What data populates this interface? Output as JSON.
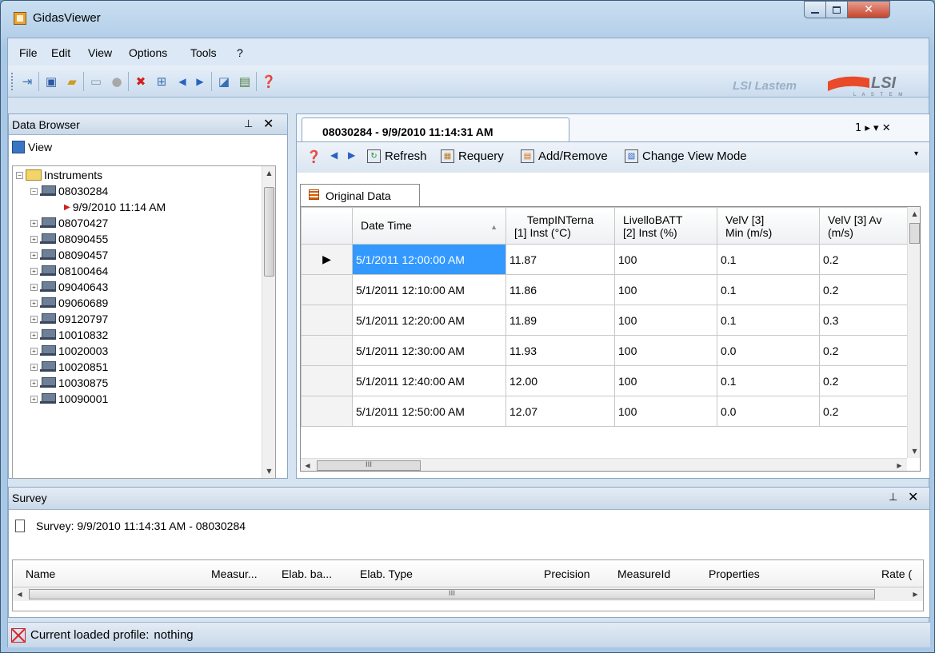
{
  "window": {
    "title": "GidasViewer"
  },
  "menu": [
    "File",
    "Edit",
    "View",
    "Options",
    "Tools",
    "?"
  ],
  "toolbar": {
    "icons": [
      "exit-icon",
      "save-icon",
      "open-folder-icon",
      "connect-icon",
      "disconnect-icon",
      "delete-icon",
      "grid-icon",
      "previous-icon",
      "next-icon",
      "chart-icon",
      "report-icon",
      "help-icon"
    ],
    "brand": "LSI Lastem",
    "logo": "LSI"
  },
  "data_browser": {
    "title": "Data Browser",
    "view_label": "View",
    "tree": {
      "root": "Instruments",
      "expanded": {
        "label": "08030284",
        "child": "9/9/2010 11:14 AM"
      },
      "items": [
        "08070427",
        "08090455",
        "08090457",
        "08100464",
        "09040643",
        "09060689",
        "09120797",
        "10010832",
        "10020003",
        "10020851",
        "10030875",
        "10090001"
      ]
    }
  },
  "document": {
    "tab_title": "08030284 - 9/9/2010 11:14:31 AM",
    "tab_controls": "1 ▸ ▾ ✕",
    "toolstrip": {
      "refresh": "Refresh",
      "requery": "Requery",
      "add_remove": "Add/Remove",
      "change_view_mode": "Change View Mode"
    },
    "sub_tab": "Original Data",
    "grid": {
      "columns": [
        {
          "line1": "Date Time",
          "line2": ""
        },
        {
          "line1": "TempINTerna",
          "line2": "[1] Inst (°C)"
        },
        {
          "line1": "LivelloBATT",
          "line2": "[2] Inst (%)"
        },
        {
          "line1": "VelV [3]",
          "line2": "Min (m/s)"
        },
        {
          "line1": "VelV [3] Av",
          "line2": "(m/s)"
        }
      ],
      "rows": [
        [
          "5/1/2011 12:00:00 AM",
          "11.87",
          "100",
          "0.1",
          "0.2"
        ],
        [
          "5/1/2011 12:10:00 AM",
          "11.86",
          "100",
          "0.1",
          "0.2"
        ],
        [
          "5/1/2011 12:20:00 AM",
          "11.89",
          "100",
          "0.1",
          "0.3"
        ],
        [
          "5/1/2011 12:30:00 AM",
          "11.93",
          "100",
          "0.0",
          "0.2"
        ],
        [
          "5/1/2011 12:40:00 AM",
          "12.00",
          "100",
          "0.1",
          "0.2"
        ],
        [
          "5/1/2011 12:50:00 AM",
          "12.07",
          "100",
          "0.0",
          "0.2"
        ]
      ],
      "hscroll_grip": "III"
    }
  },
  "survey": {
    "title": "Survey",
    "caption": "Survey: 9/9/2010 11:14:31 AM - 08030284",
    "columns": [
      "Name",
      "Measur...",
      "Elab. ba...",
      "Elab. Type",
      "Precision",
      "MeasureId",
      "Properties",
      "Rate ("
    ],
    "hscroll_grip": "III"
  },
  "status": {
    "label": "Current loaded profile:",
    "value": "nothing"
  },
  "colors": {
    "selection": "#3399ff",
    "close_button": "#c5452d",
    "title_accent": "#1d4b87"
  }
}
